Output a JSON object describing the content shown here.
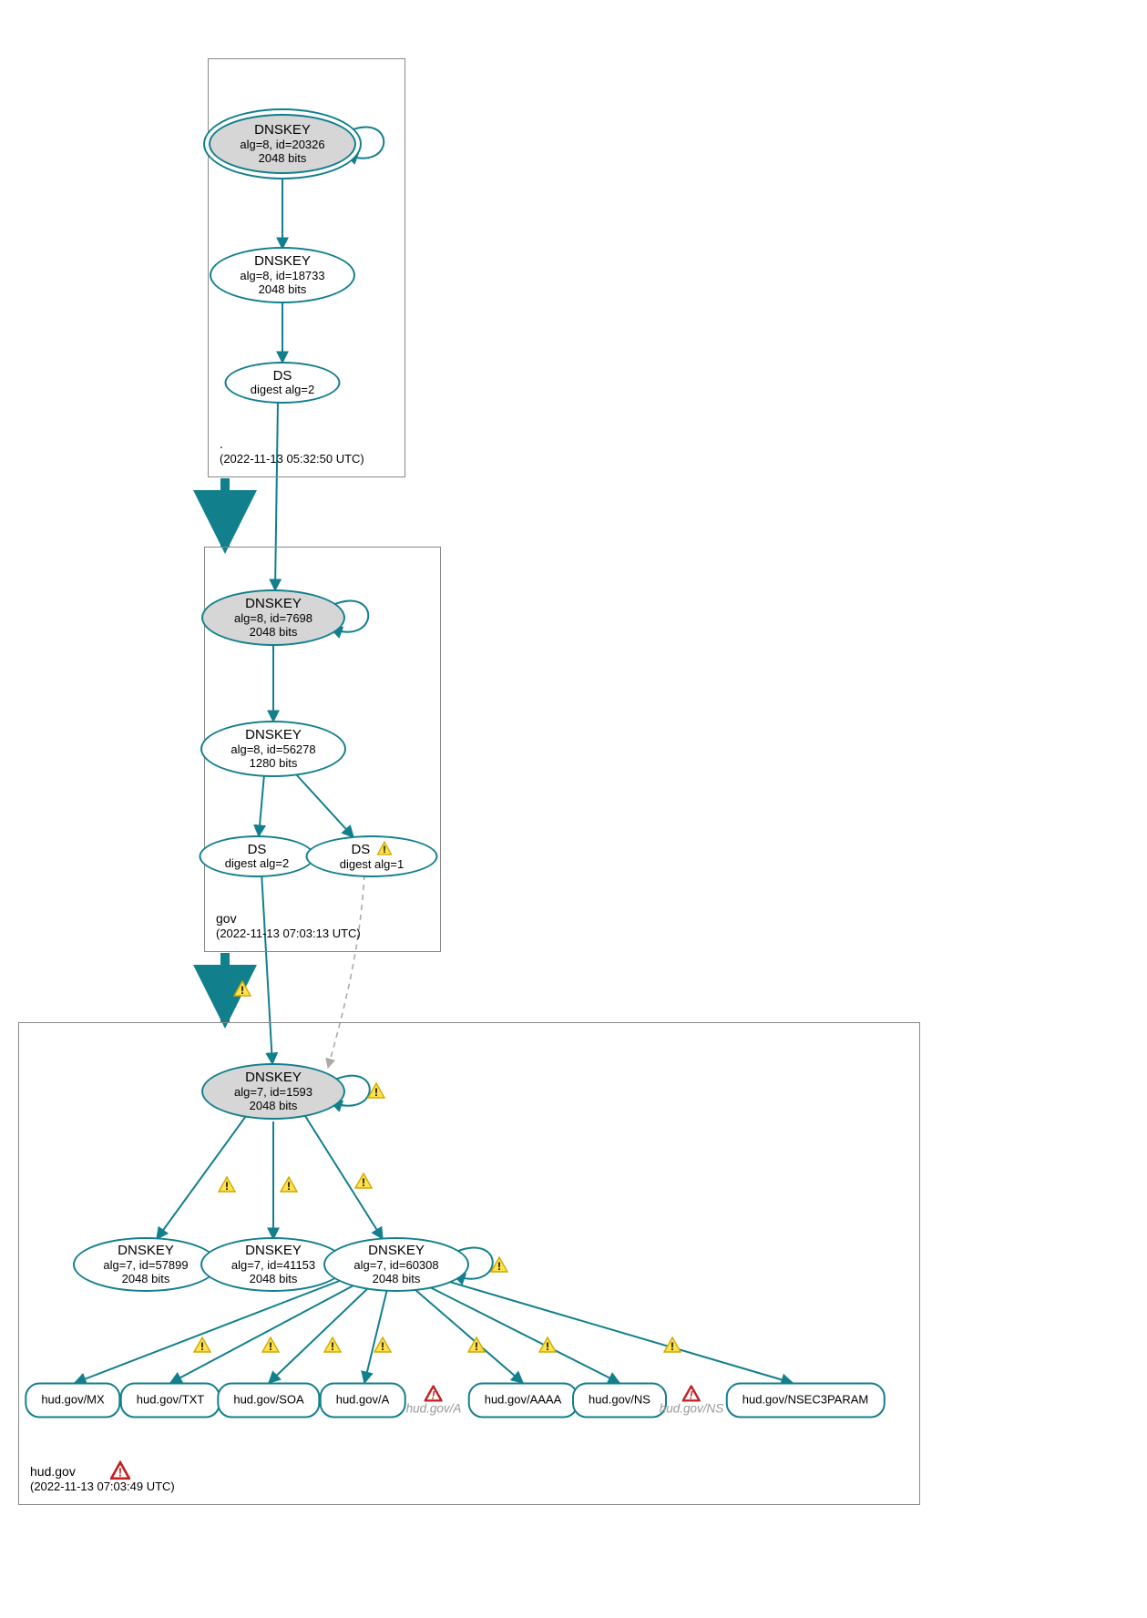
{
  "colors": {
    "teal": "#127f8d",
    "gray": "#d6d6d6",
    "warn_fill": "#ffe24d",
    "warn_stroke": "#d1a800",
    "err_stroke": "#c31f1f"
  },
  "zones": {
    "root": {
      "name": ".",
      "timestamp": "(2022-11-13 05:32:50 UTC)"
    },
    "gov": {
      "name": "gov",
      "timestamp": "(2022-11-13 07:03:13 UTC)"
    },
    "hudgov": {
      "name": "hud.gov",
      "timestamp": "(2022-11-13 07:03:49 UTC)"
    }
  },
  "nodes": {
    "root_ksk": {
      "title": "DNSKEY",
      "line2": "alg=8, id=20326",
      "line3": "2048 bits"
    },
    "root_zsk": {
      "title": "DNSKEY",
      "line2": "alg=8, id=18733",
      "line3": "2048 bits"
    },
    "root_ds": {
      "title": "DS",
      "line2": "digest alg=2"
    },
    "gov_ksk": {
      "title": "DNSKEY",
      "line2": "alg=8, id=7698",
      "line3": "2048 bits"
    },
    "gov_zsk": {
      "title": "DNSKEY",
      "line2": "alg=8, id=56278",
      "line3": "1280 bits"
    },
    "gov_ds2": {
      "title": "DS",
      "line2": "digest alg=2"
    },
    "gov_ds1": {
      "title": "DS",
      "line2": "digest alg=1"
    },
    "hud_ksk": {
      "title": "DNSKEY",
      "line2": "alg=7, id=1593",
      "line3": "2048 bits"
    },
    "hud_k1": {
      "title": "DNSKEY",
      "line2": "alg=7, id=57899",
      "line3": "2048 bits"
    },
    "hud_k2": {
      "title": "DNSKEY",
      "line2": "alg=7, id=41153",
      "line3": "2048 bits"
    },
    "hud_k3": {
      "title": "DNSKEY",
      "line2": "alg=7, id=60308",
      "line3": "2048 bits"
    }
  },
  "rr": {
    "mx": "hud.gov/MX",
    "txt": "hud.gov/TXT",
    "soa": "hud.gov/SOA",
    "a": "hud.gov/A",
    "aaaa": "hud.gov/AAAA",
    "ns": "hud.gov/NS",
    "nsec": "hud.gov/NSEC3PARAM"
  },
  "ghost": {
    "a": "hud.gov/A",
    "ns": "hud.gov/NS"
  }
}
